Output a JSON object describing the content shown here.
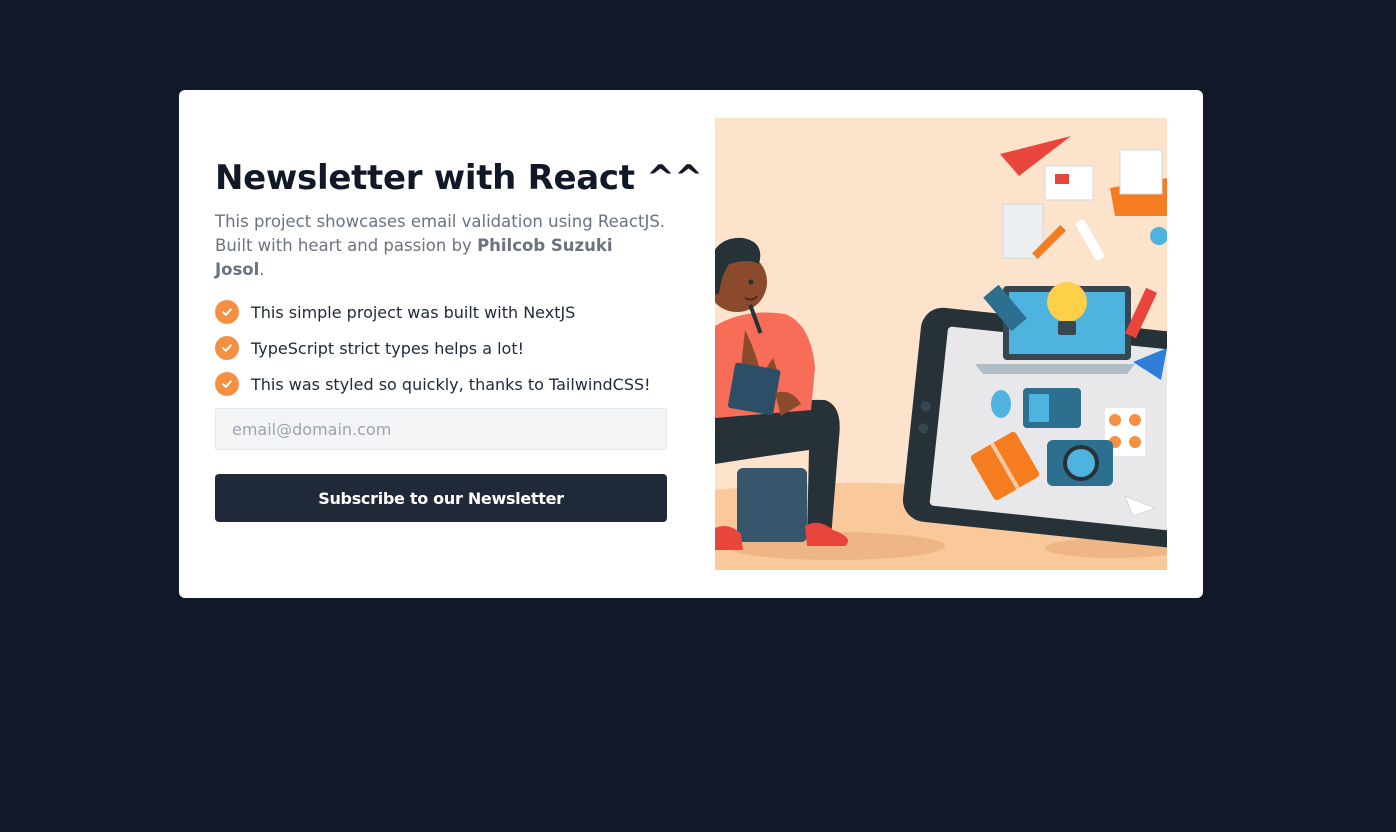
{
  "newsletter": {
    "title": "Newsletter with React ^^",
    "description_prefix": "This project showcases email validation using ReactJS. Built with heart and passion by ",
    "author": "Philcob Suzuki Josol",
    "description_suffix": ".",
    "features": [
      {
        "icon": "check-icon",
        "text": "This simple project was built with NextJS"
      },
      {
        "icon": "check-icon",
        "text": "TypeScript strict types helps a lot!"
      },
      {
        "icon": "check-icon",
        "text": "This was styled so quickly, thanks to TailwindCSS!"
      }
    ],
    "email": {
      "value": "",
      "placeholder": "email@domain.com"
    },
    "subscribe_label": "Subscribe to our Newsletter",
    "illustration": "person-with-tablet-illustration"
  },
  "colors": {
    "page_background": "#111827",
    "card_background": "#ffffff",
    "accent": "#f59042",
    "button_background": "#1f2937",
    "illustration_background": "#fde3cc"
  }
}
